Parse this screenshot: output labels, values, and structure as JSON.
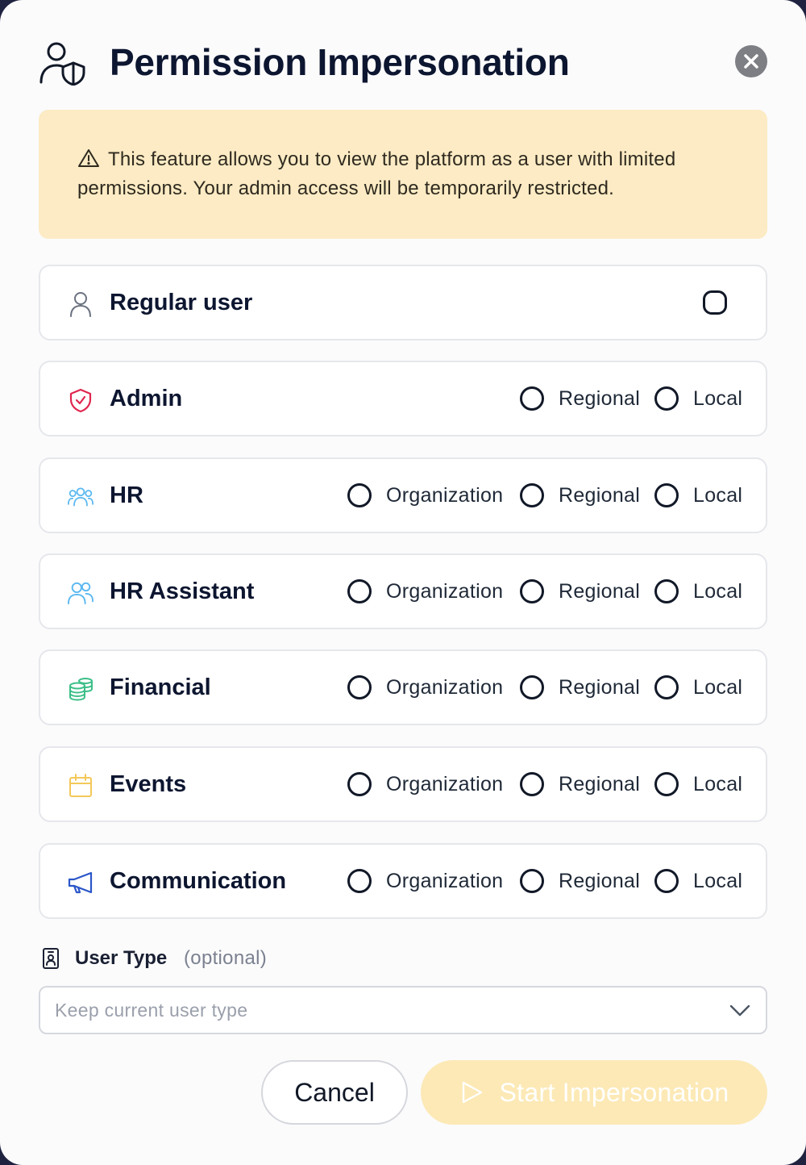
{
  "dialog": {
    "title": "Permission Impersonation",
    "title_icon": "user-shield-icon",
    "close_icon": "close-icon"
  },
  "warning": {
    "icon": "warning-triangle-icon",
    "line1": "This feature allows you to view the platform as a user with limited",
    "line2": "permissions. Your admin access will be temporarily restricted."
  },
  "roles": [
    {
      "label": "Regular user",
      "icon": "user-icon",
      "options": []
    },
    {
      "label": "Admin",
      "icon": "shield-check-icon",
      "options": [
        "Regional",
        "Local"
      ]
    },
    {
      "label": "HR",
      "icon": "users-group-icon",
      "options": [
        "Organization",
        "Regional",
        "Local"
      ]
    },
    {
      "label": "HR Assistant",
      "icon": "users-icon",
      "options": [
        "Organization",
        "Regional",
        "Local"
      ]
    },
    {
      "label": "Financial",
      "icon": "coins-icon",
      "options": [
        "Organization",
        "Regional",
        "Local"
      ]
    },
    {
      "label": "Events",
      "icon": "calendar-icon",
      "options": [
        "Organization",
        "Regional",
        "Local"
      ]
    },
    {
      "label": "Communication",
      "icon": "megaphone-icon",
      "options": [
        "Organization",
        "Regional",
        "Local"
      ]
    }
  ],
  "user_type": {
    "label": "User Type",
    "optional": "(optional)",
    "icon": "id-badge-icon",
    "select_value": "Keep current user type",
    "select_icon": "chevron-down-icon"
  },
  "actions": {
    "cancel": "Cancel",
    "start": "Start Impersonation",
    "start_icon": "play-icon"
  },
  "colors": {
    "warning_bg": "#fcebc4",
    "start_bg": "#fce9b6",
    "admin_icon": "#e0264f",
    "hr_icon": "#5ab8f0",
    "financial_icon": "#3cbf88",
    "events_icon": "#f4c85a",
    "communication_icon": "#2b56c9"
  }
}
